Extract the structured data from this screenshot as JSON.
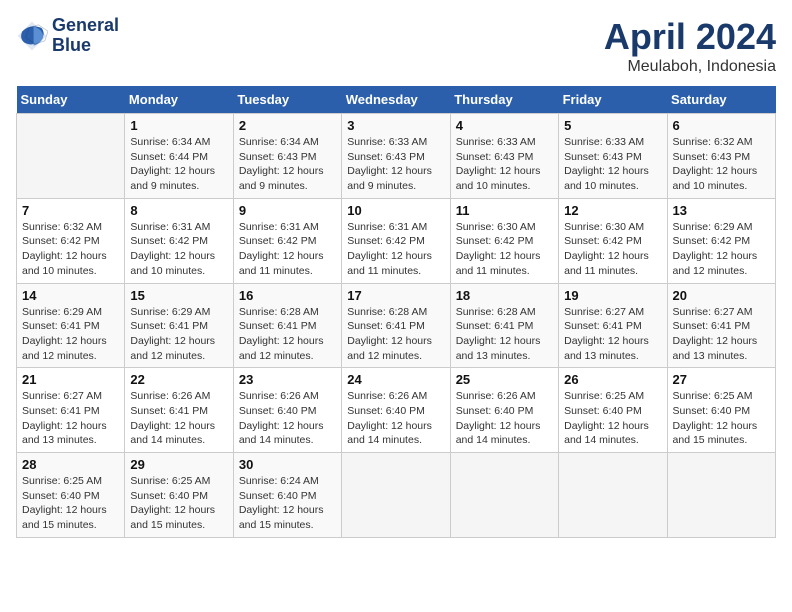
{
  "logo": {
    "line1": "General",
    "line2": "Blue"
  },
  "title": "April 2024",
  "location": "Meulaboh, Indonesia",
  "days_of_week": [
    "Sunday",
    "Monday",
    "Tuesday",
    "Wednesday",
    "Thursday",
    "Friday",
    "Saturday"
  ],
  "weeks": [
    [
      {
        "num": "",
        "info": ""
      },
      {
        "num": "1",
        "info": "Sunrise: 6:34 AM\nSunset: 6:44 PM\nDaylight: 12 hours\nand 9 minutes."
      },
      {
        "num": "2",
        "info": "Sunrise: 6:34 AM\nSunset: 6:43 PM\nDaylight: 12 hours\nand 9 minutes."
      },
      {
        "num": "3",
        "info": "Sunrise: 6:33 AM\nSunset: 6:43 PM\nDaylight: 12 hours\nand 9 minutes."
      },
      {
        "num": "4",
        "info": "Sunrise: 6:33 AM\nSunset: 6:43 PM\nDaylight: 12 hours\nand 10 minutes."
      },
      {
        "num": "5",
        "info": "Sunrise: 6:33 AM\nSunset: 6:43 PM\nDaylight: 12 hours\nand 10 minutes."
      },
      {
        "num": "6",
        "info": "Sunrise: 6:32 AM\nSunset: 6:43 PM\nDaylight: 12 hours\nand 10 minutes."
      }
    ],
    [
      {
        "num": "7",
        "info": "Sunrise: 6:32 AM\nSunset: 6:42 PM\nDaylight: 12 hours\nand 10 minutes."
      },
      {
        "num": "8",
        "info": "Sunrise: 6:31 AM\nSunset: 6:42 PM\nDaylight: 12 hours\nand 10 minutes."
      },
      {
        "num": "9",
        "info": "Sunrise: 6:31 AM\nSunset: 6:42 PM\nDaylight: 12 hours\nand 11 minutes."
      },
      {
        "num": "10",
        "info": "Sunrise: 6:31 AM\nSunset: 6:42 PM\nDaylight: 12 hours\nand 11 minutes."
      },
      {
        "num": "11",
        "info": "Sunrise: 6:30 AM\nSunset: 6:42 PM\nDaylight: 12 hours\nand 11 minutes."
      },
      {
        "num": "12",
        "info": "Sunrise: 6:30 AM\nSunset: 6:42 PM\nDaylight: 12 hours\nand 11 minutes."
      },
      {
        "num": "13",
        "info": "Sunrise: 6:29 AM\nSunset: 6:42 PM\nDaylight: 12 hours\nand 12 minutes."
      }
    ],
    [
      {
        "num": "14",
        "info": "Sunrise: 6:29 AM\nSunset: 6:41 PM\nDaylight: 12 hours\nand 12 minutes."
      },
      {
        "num": "15",
        "info": "Sunrise: 6:29 AM\nSunset: 6:41 PM\nDaylight: 12 hours\nand 12 minutes."
      },
      {
        "num": "16",
        "info": "Sunrise: 6:28 AM\nSunset: 6:41 PM\nDaylight: 12 hours\nand 12 minutes."
      },
      {
        "num": "17",
        "info": "Sunrise: 6:28 AM\nSunset: 6:41 PM\nDaylight: 12 hours\nand 12 minutes."
      },
      {
        "num": "18",
        "info": "Sunrise: 6:28 AM\nSunset: 6:41 PM\nDaylight: 12 hours\nand 13 minutes."
      },
      {
        "num": "19",
        "info": "Sunrise: 6:27 AM\nSunset: 6:41 PM\nDaylight: 12 hours\nand 13 minutes."
      },
      {
        "num": "20",
        "info": "Sunrise: 6:27 AM\nSunset: 6:41 PM\nDaylight: 12 hours\nand 13 minutes."
      }
    ],
    [
      {
        "num": "21",
        "info": "Sunrise: 6:27 AM\nSunset: 6:41 PM\nDaylight: 12 hours\nand 13 minutes."
      },
      {
        "num": "22",
        "info": "Sunrise: 6:26 AM\nSunset: 6:41 PM\nDaylight: 12 hours\nand 14 minutes."
      },
      {
        "num": "23",
        "info": "Sunrise: 6:26 AM\nSunset: 6:40 PM\nDaylight: 12 hours\nand 14 minutes."
      },
      {
        "num": "24",
        "info": "Sunrise: 6:26 AM\nSunset: 6:40 PM\nDaylight: 12 hours\nand 14 minutes."
      },
      {
        "num": "25",
        "info": "Sunrise: 6:26 AM\nSunset: 6:40 PM\nDaylight: 12 hours\nand 14 minutes."
      },
      {
        "num": "26",
        "info": "Sunrise: 6:25 AM\nSunset: 6:40 PM\nDaylight: 12 hours\nand 14 minutes."
      },
      {
        "num": "27",
        "info": "Sunrise: 6:25 AM\nSunset: 6:40 PM\nDaylight: 12 hours\nand 15 minutes."
      }
    ],
    [
      {
        "num": "28",
        "info": "Sunrise: 6:25 AM\nSunset: 6:40 PM\nDaylight: 12 hours\nand 15 minutes."
      },
      {
        "num": "29",
        "info": "Sunrise: 6:25 AM\nSunset: 6:40 PM\nDaylight: 12 hours\nand 15 minutes."
      },
      {
        "num": "30",
        "info": "Sunrise: 6:24 AM\nSunset: 6:40 PM\nDaylight: 12 hours\nand 15 minutes."
      },
      {
        "num": "",
        "info": ""
      },
      {
        "num": "",
        "info": ""
      },
      {
        "num": "",
        "info": ""
      },
      {
        "num": "",
        "info": ""
      }
    ]
  ]
}
